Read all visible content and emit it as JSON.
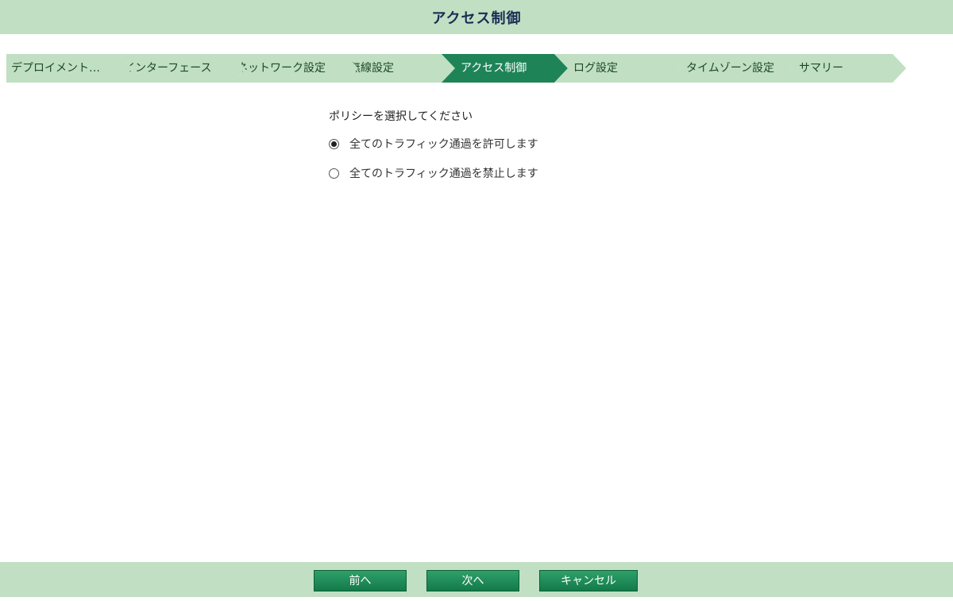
{
  "header": {
    "title": "アクセス制御"
  },
  "steps": [
    {
      "label": "デプロイメント…",
      "active": false
    },
    {
      "label": "インターフェース",
      "active": false
    },
    {
      "label": "ネットワーク設定",
      "active": false
    },
    {
      "label": "無線設定",
      "active": false
    },
    {
      "label": "アクセス制御",
      "active": true
    },
    {
      "label": "ログ設定",
      "active": false
    },
    {
      "label": "タイムゾーン設定",
      "active": false
    },
    {
      "label": "サマリー",
      "active": false
    }
  ],
  "policy": {
    "prompt": "ポリシーを選択してください",
    "options": [
      {
        "label": "全てのトラフィック通過を許可します",
        "checked": true
      },
      {
        "label": "全てのトラフィック通過を禁止します",
        "checked": false
      }
    ]
  },
  "footer": {
    "prev_label": "前へ",
    "next_label": "次へ",
    "cancel_label": "キャンセル"
  },
  "colors": {
    "bar_bg": "#c1dfc2",
    "active_step": "#1e8457",
    "title_text": "#1a2d55",
    "button": "#1e8457"
  }
}
